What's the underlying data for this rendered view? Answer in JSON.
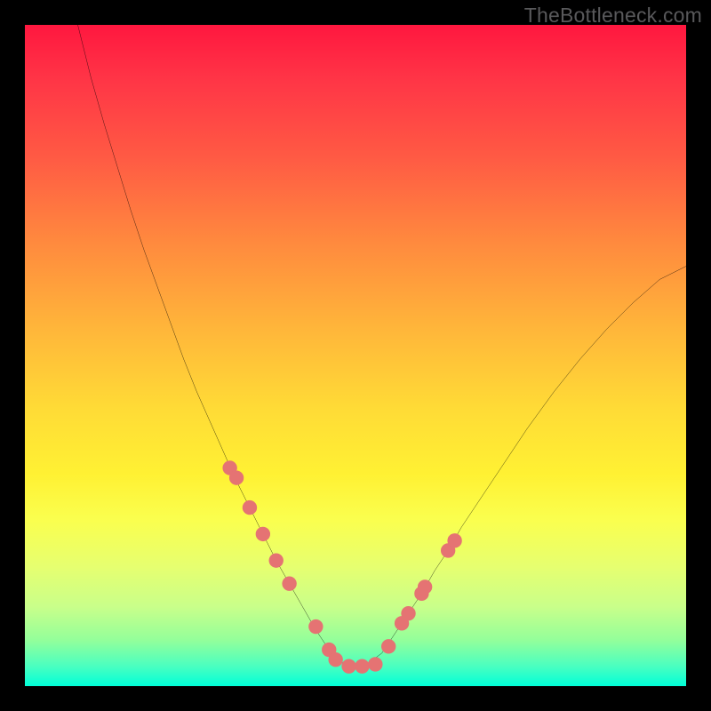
{
  "watermark": "TheBottleneck.com",
  "chart_data": {
    "type": "line",
    "title": "",
    "xlabel": "",
    "ylabel": "",
    "xlim": [
      0,
      100
    ],
    "ylim": [
      0,
      100
    ],
    "grid": false,
    "series": [
      {
        "name": "bottleneck-curve",
        "color": "#000000",
        "x": [
          8,
          10,
          12,
          14,
          16,
          18,
          20,
          22,
          24,
          26,
          28,
          30,
          32,
          34,
          36,
          38,
          40,
          42,
          44,
          46,
          48,
          49,
          50,
          52,
          54,
          56,
          58,
          60,
          62,
          64,
          66,
          68,
          70,
          72,
          76,
          80,
          84,
          88,
          92,
          96,
          100
        ],
        "values": [
          100,
          92,
          85,
          78.5,
          72,
          66,
          60.5,
          55,
          49.5,
          44.5,
          40,
          35.5,
          31,
          27,
          23,
          19,
          15.5,
          12,
          8.5,
          5.5,
          3.5,
          3,
          3,
          3.5,
          5,
          8,
          11,
          14,
          17.5,
          20.5,
          24,
          27,
          30,
          33,
          39,
          44.5,
          49.5,
          54,
          58,
          61.5,
          63.5
        ]
      }
    ],
    "markers": {
      "name": "sample-points",
      "color": "#e57373",
      "radius": 1.1,
      "x": [
        31,
        32,
        34,
        36,
        38,
        40,
        44,
        46,
        47,
        49,
        51,
        53,
        55,
        57,
        58,
        60,
        60.5,
        64,
        65
      ],
      "values": [
        33,
        31.5,
        27,
        23,
        19,
        15.5,
        9,
        5.5,
        4,
        3,
        3,
        3.3,
        6,
        9.5,
        11,
        14,
        15,
        20.5,
        22
      ]
    },
    "gradient_stops": [
      {
        "pos": 0,
        "color": "#ff173f"
      },
      {
        "pos": 8,
        "color": "#ff3446"
      },
      {
        "pos": 20,
        "color": "#ff5a44"
      },
      {
        "pos": 33,
        "color": "#ff8a3e"
      },
      {
        "pos": 46,
        "color": "#ffb63a"
      },
      {
        "pos": 58,
        "color": "#ffdb36"
      },
      {
        "pos": 68,
        "color": "#fff133"
      },
      {
        "pos": 75,
        "color": "#faff4f"
      },
      {
        "pos": 82,
        "color": "#e6ff70"
      },
      {
        "pos": 88,
        "color": "#c9ff8a"
      },
      {
        "pos": 93,
        "color": "#94ff9a"
      },
      {
        "pos": 97,
        "color": "#4affc0"
      },
      {
        "pos": 100,
        "color": "#00ffd8"
      }
    ]
  }
}
